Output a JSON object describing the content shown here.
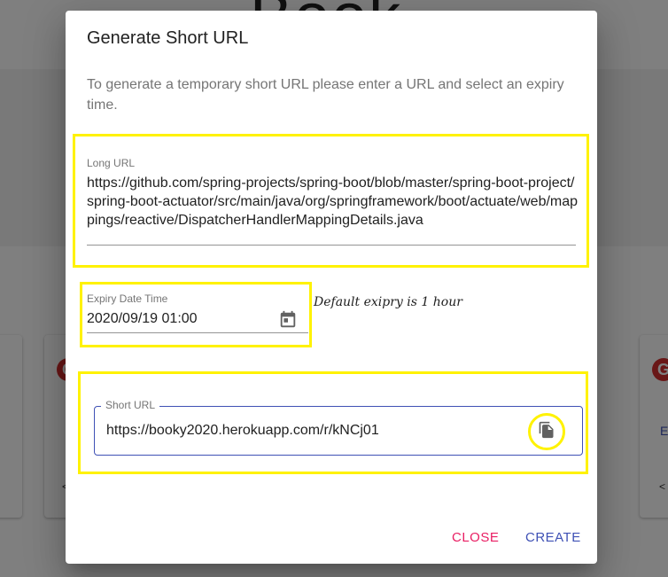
{
  "background": {
    "title_fragment": "Book",
    "card_logo_letter": "G",
    "card_link_text": "E"
  },
  "dialog": {
    "title": "Generate Short URL",
    "description": "To generate a temporary short URL please enter a URL and select an expiry time.",
    "long_url": {
      "label": "Long URL",
      "value": "https://github.com/spring-projects/spring-boot/blob/master/spring-boot-project/spring-boot-actuator/src/main/java/org/springframework/boot/actuate/web/mappings/reactive/DispatcherHandlerMappingDetails.java"
    },
    "expiry": {
      "label": "Expiry Date Time",
      "value": "2020/09/19 01:00",
      "hint": "Default exipry is 1 hour",
      "icon": "calendar-icon"
    },
    "short_url": {
      "label": "Short URL",
      "value": "https://booky2020.herokuapp.com/r/kNCj01",
      "copy_icon": "copy-icon"
    },
    "actions": {
      "close_label": "CLOSE",
      "create_label": "CREATE"
    },
    "colors": {
      "primary": "#3f51b5",
      "secondary": "#e91e63",
      "highlight": "#fff200"
    }
  }
}
